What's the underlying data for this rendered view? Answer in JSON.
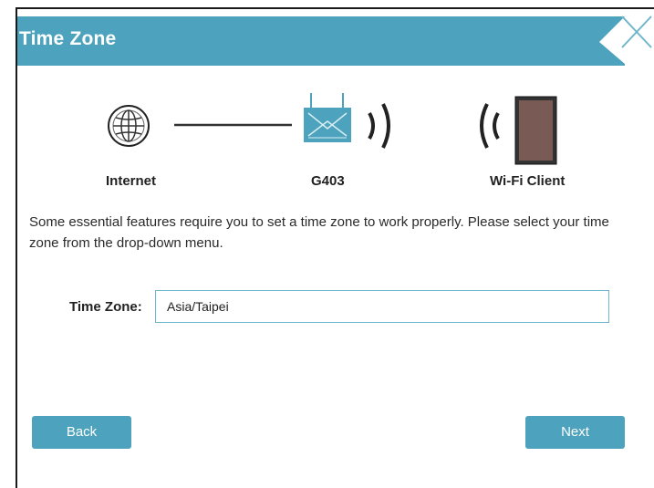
{
  "dialog": {
    "title": "Time Zone"
  },
  "diagram": {
    "internet_label": "Internet",
    "device_label": "G403",
    "client_label": "Wi-Fi Client",
    "icons": [
      "globe-icon",
      "router-icon",
      "signal-waves-icon",
      "tablet-icon"
    ]
  },
  "message": "Some essential features require you to set a time zone to work properly. Please select your time zone from the drop-down menu.",
  "timezone": {
    "label": "Time Zone:",
    "value": "Asia/Taipei"
  },
  "buttons": {
    "back": "Back",
    "next": "Next"
  },
  "colors": {
    "accent": "#4da3bd",
    "field_border": "#6fb5cb",
    "frame": "#1a1a1a"
  }
}
